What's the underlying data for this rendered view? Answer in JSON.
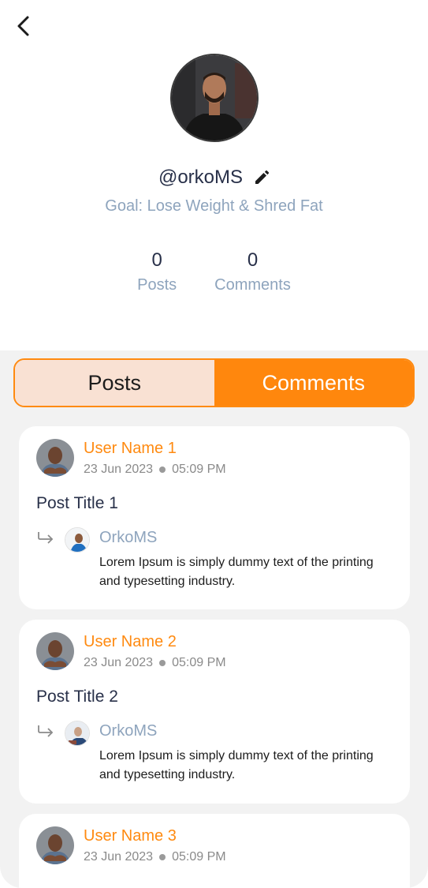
{
  "header": {
    "back_icon": "chevron-left-icon"
  },
  "profile": {
    "handle": "@orkoMS",
    "edit_icon": "pencil-icon",
    "goal": "Goal: Lose Weight & Shred Fat",
    "stats": [
      {
        "value": "0",
        "label": "Posts"
      },
      {
        "value": "0",
        "label": "Comments"
      }
    ]
  },
  "tabs": [
    {
      "label": "Posts",
      "active": false
    },
    {
      "label": "Comments",
      "active": true
    }
  ],
  "comments": [
    {
      "user_name": "User Name 1",
      "date": "23 Jun 2023",
      "time": "05:09 PM",
      "post_title": "Post Title  1",
      "reply_name": "OrkoMS",
      "reply_text": "Lorem Ipsum is simply dummy text of the printing and typesetting industry."
    },
    {
      "user_name": "User Name 2",
      "date": "23 Jun 2023",
      "time": "05:09 PM",
      "post_title": "Post Title  2",
      "reply_name": "OrkoMS",
      "reply_text": "Lorem Ipsum is simply dummy text of the printing and typesetting industry."
    },
    {
      "user_name": "User Name 3",
      "date": "23 Jun 2023",
      "time": "05:09 PM"
    }
  ],
  "colors": {
    "accent": "#ff870d",
    "tab_inactive_bg": "#f9e1d3",
    "muted_blue": "#8ea4bd",
    "text_dark": "#283049",
    "panel_bg": "#f2f2f2"
  }
}
